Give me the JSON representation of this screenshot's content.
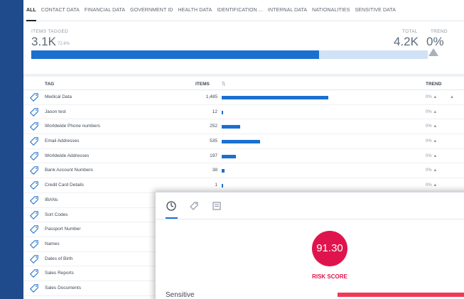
{
  "tabs": [
    "ALL",
    "CONTACT DATA",
    "FINANCIAL DATA",
    "GOVERNMENT ID",
    "HEALTH DATA",
    "IDENTIFICATION ...",
    "INTERNAL DATA",
    "NATIONALITIES",
    "SENSITIVE DATA"
  ],
  "summary": {
    "items_tagged_label": "ITEMS TAGGED",
    "items_tagged_value": "3.1K",
    "items_tagged_pct": "72.6%",
    "total_label": "TOTAL",
    "total_value": "4.2K",
    "trend_label": "TREND",
    "trend_value": "0%",
    "progress_fraction": 0.726
  },
  "table": {
    "columns": {
      "tag": "TAG",
      "items": "ITEMS",
      "trend": "TREND"
    },
    "rows": [
      {
        "name": "Medical Data",
        "count": "1,485",
        "fraction": 1.0,
        "trend": "0% ▲"
      },
      {
        "name": "Jason test",
        "count": "12",
        "fraction": 0.008,
        "trend": "0% ▲"
      },
      {
        "name": "Worldwide Phone numbers",
        "count": "252",
        "fraction": 0.17,
        "trend": "0% ▲"
      },
      {
        "name": "Email Addresses",
        "count": "535",
        "fraction": 0.36,
        "trend": "0% ▲"
      },
      {
        "name": "Worldwide Addresses",
        "count": "197",
        "fraction": 0.133,
        "trend": "0% ▲"
      },
      {
        "name": "Bank Account Numbers",
        "count": "38",
        "fraction": 0.026,
        "trend": "0% ▲"
      },
      {
        "name": "Credit Card Details",
        "count": "1",
        "fraction": 0.002,
        "trend": "0% ▲"
      },
      {
        "name": "IBANs",
        "count": "",
        "fraction": 0,
        "trend": ""
      },
      {
        "name": "Sort Codes",
        "count": "",
        "fraction": 0,
        "trend": ""
      },
      {
        "name": "Passport Number",
        "count": "",
        "fraction": 0,
        "trend": ""
      },
      {
        "name": "Names",
        "count": "",
        "fraction": 0,
        "trend": ""
      },
      {
        "name": "Dates of Birth",
        "count": "",
        "fraction": 0,
        "trend": ""
      },
      {
        "name": "Sales Reports",
        "count": "",
        "fraction": 0,
        "trend": ""
      },
      {
        "name": "Sales Documents",
        "count": "",
        "fraction": 0,
        "trend": ""
      }
    ]
  },
  "overlay": {
    "tab_icons": [
      "gauge-icon",
      "tag-icon",
      "document-icon"
    ],
    "risk_score_value": "91.30",
    "risk_score_label": "RISK SCORE",
    "sensitive_label": "Sensitive"
  },
  "colors": {
    "accent": "#1a6fd1",
    "risk": "#e0144c",
    "background": "#1f4a8c"
  }
}
